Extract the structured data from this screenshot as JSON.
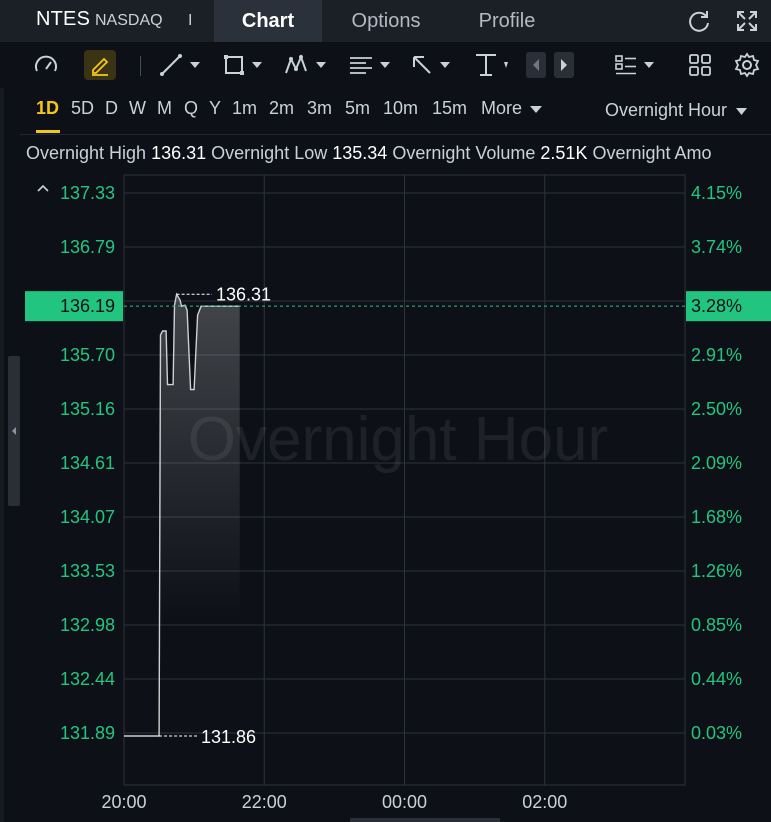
{
  "header": {
    "ticker": "NTES",
    "exchange": "NASDAQ",
    "separator": "I",
    "tabs": [
      {
        "label": "Chart",
        "active": true
      },
      {
        "label": "Options",
        "active": false
      },
      {
        "label": "Profile",
        "active": false
      }
    ],
    "icons": [
      "refresh-icon",
      "expand-icon"
    ]
  },
  "toolbar": {
    "icons": [
      "speedometer-icon",
      "pencil-icon",
      "line-tool-icon",
      "rectangle-tool-icon",
      "pattern-tool-icon",
      "text-tool-icon",
      "arrow-tool-icon",
      "measure-tool-icon",
      "scroll-left-icon",
      "scroll-right-icon",
      "indicators-icon",
      "layout-icon",
      "settings-icon"
    ]
  },
  "timeframes": {
    "items": [
      "1D",
      "5D",
      "D",
      "W",
      "M",
      "Q",
      "Y",
      "1m",
      "2m",
      "3m",
      "5m",
      "10m",
      "15m",
      "More"
    ],
    "active": "1D",
    "session": "Overnight Hour"
  },
  "stats": {
    "high_label": "Overnight High",
    "high_value": "136.31",
    "low_label": "Overnight Low",
    "low_value": "135.34",
    "volume_label": "Overnight Volume",
    "volume_value": "2.51K",
    "amount_label": "Overnight Amo"
  },
  "colors": {
    "accent": "#f5c518",
    "price_axis": "#22c580",
    "current_price_bg": "#22c580",
    "line": "#d0d0d0",
    "background": "#0d1117"
  },
  "chart_data": {
    "type": "line",
    "watermark": "Overnight Hour",
    "x_ticks": [
      "20:00",
      "22:00",
      "00:00",
      "02:00"
    ],
    "y_left_ticks": [
      "137.33",
      "136.79",
      "136.19",
      "135.70",
      "135.16",
      "134.61",
      "134.07",
      "133.53",
      "132.98",
      "132.44",
      "131.89"
    ],
    "y_right_ticks": [
      "4.15%",
      "3.74%",
      "3.28%",
      "2.91%",
      "2.50%",
      "2.09%",
      "1.68%",
      "1.26%",
      "0.85%",
      "0.44%",
      "0.03%"
    ],
    "current_price": "136.19",
    "current_pct": "3.28%",
    "high_marker": "136.31",
    "low_marker": "131.86",
    "ylim": [
      131.89,
      137.33
    ],
    "xlim_hours": [
      20,
      28
    ],
    "x": [
      20.0,
      20.5,
      20.52,
      20.55,
      20.6,
      20.62,
      20.7,
      20.72,
      20.75,
      20.8,
      20.82,
      20.87,
      20.9,
      20.95,
      21.0,
      21.05,
      21.1,
      21.3,
      21.5,
      21.65
    ],
    "y": [
      131.86,
      131.86,
      135.9,
      135.94,
      135.94,
      135.4,
      135.4,
      136.2,
      136.31,
      136.25,
      136.19,
      136.2,
      136.15,
      135.35,
      135.35,
      136.1,
      136.19,
      136.19,
      136.19,
      136.19
    ]
  }
}
